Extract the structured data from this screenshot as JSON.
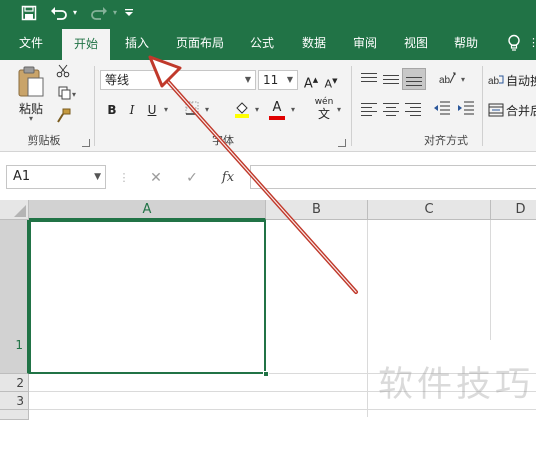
{
  "colors": {
    "brand": "#217346",
    "ribbon_bg": "#f3f3f3",
    "annotation_arrow": "#c0392b"
  },
  "qat": {
    "save_icon": "save-icon",
    "undo_icon": "undo-icon",
    "redo_icon": "redo-icon",
    "customize_icon": "chevron-down-icon"
  },
  "tabs": [
    {
      "label": "文件",
      "active": false
    },
    {
      "label": "开始",
      "active": true
    },
    {
      "label": "插入",
      "active": false
    },
    {
      "label": "页面布局",
      "active": false
    },
    {
      "label": "公式",
      "active": false
    },
    {
      "label": "数据",
      "active": false
    },
    {
      "label": "审阅",
      "active": false
    },
    {
      "label": "视图",
      "active": false
    },
    {
      "label": "帮助",
      "active": false
    }
  ],
  "ribbon": {
    "clipboard": {
      "paste_label": "粘贴",
      "group_label": "剪贴板"
    },
    "font": {
      "font_name": "等线",
      "font_size": "11",
      "group_label": "字体",
      "bold": "B",
      "italic": "I",
      "underline": "U",
      "grow": "A",
      "shrink": "A",
      "font_color": "A",
      "phonetic": "wén"
    },
    "alignment": {
      "group_label": "对齐方式",
      "wrap_label": "自动换",
      "merge_label": "合并后"
    }
  },
  "formula_bar": {
    "name_box": "A1",
    "fx": "fx",
    "value": ""
  },
  "grid": {
    "columns": [
      "A",
      "B",
      "C",
      "D"
    ],
    "rows": [
      "1",
      "2",
      "3"
    ],
    "selected_cell": "A1"
  },
  "watermark": "软件技巧"
}
